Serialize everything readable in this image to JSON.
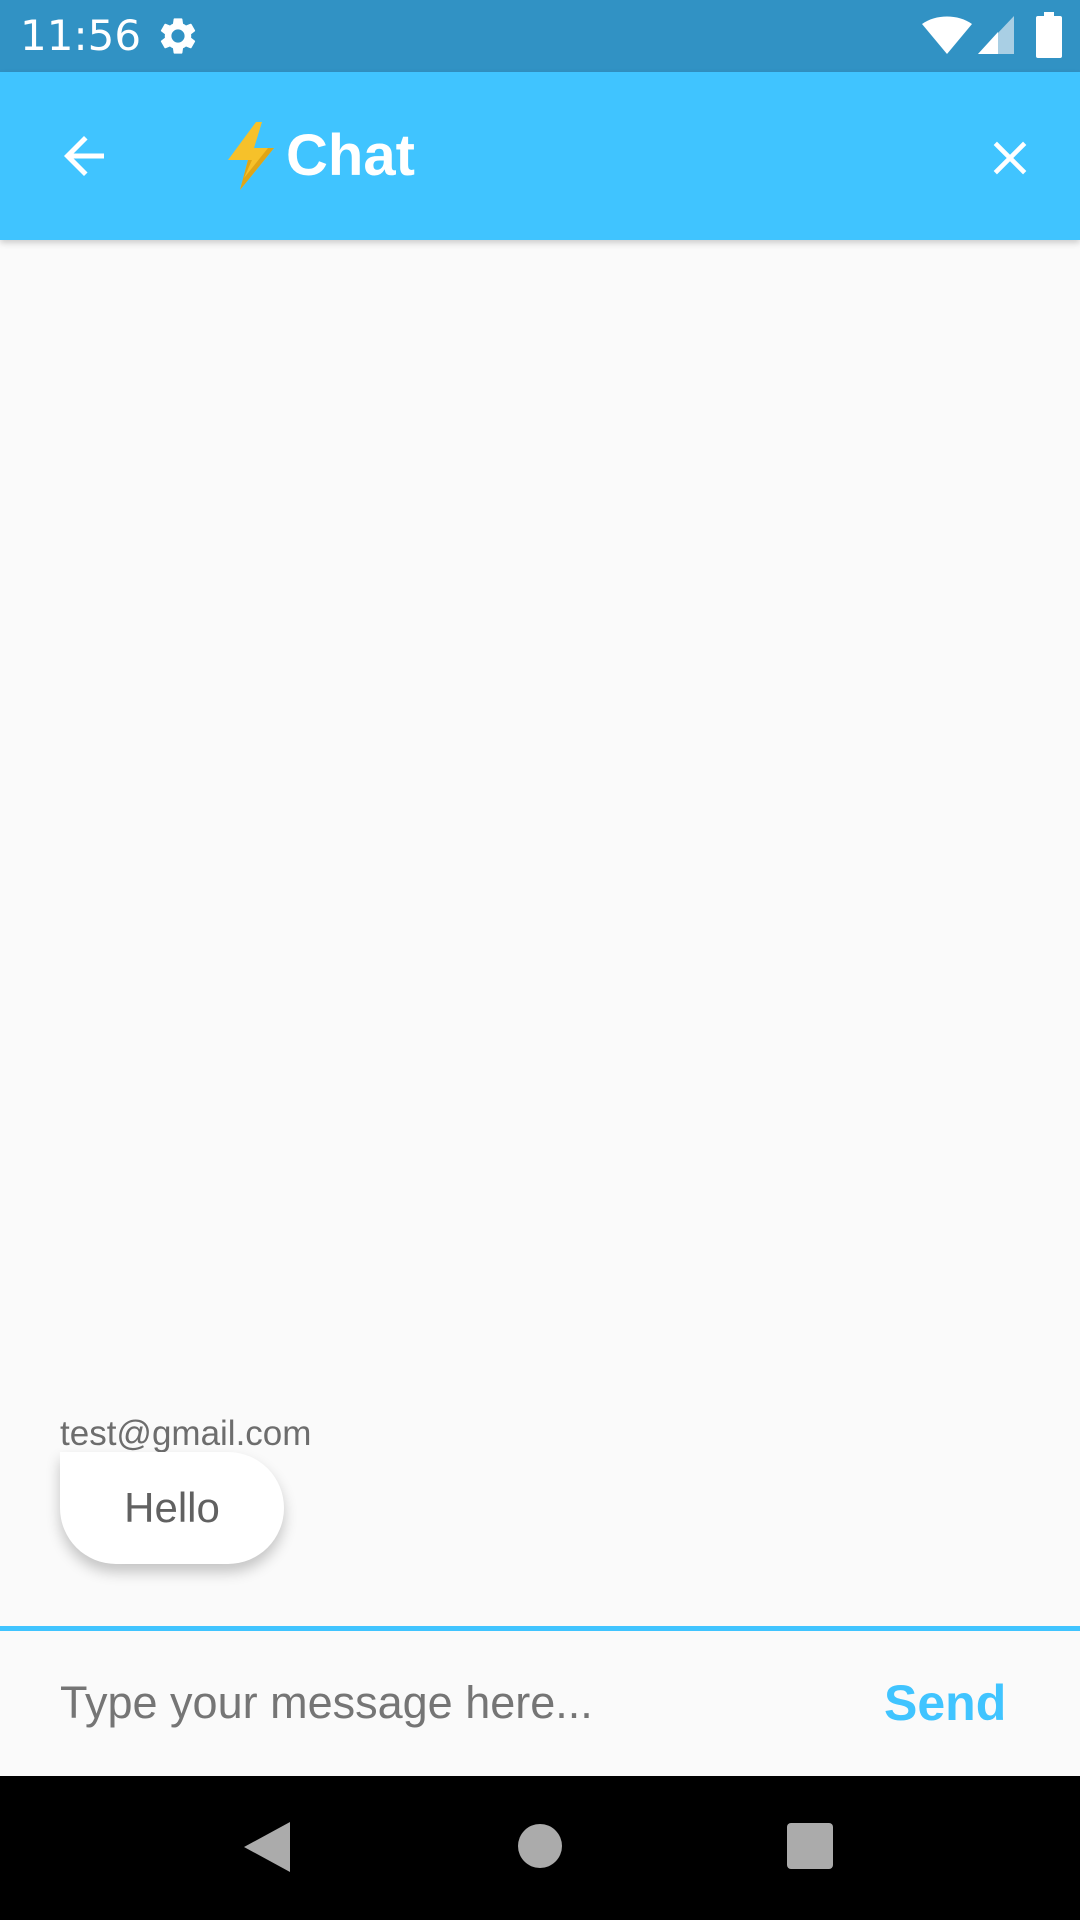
{
  "status_bar": {
    "time": "11:56",
    "icons": [
      "gear-icon",
      "wifi-icon",
      "signal-icon",
      "battery-icon"
    ]
  },
  "app_bar": {
    "back_icon": "arrow-back-icon",
    "title_icon": "lightning-bolt-icon",
    "title": "Chat",
    "close_icon": "close-icon",
    "background_color": "#40c4ff"
  },
  "messages": [
    {
      "sender": "test@gmail.com",
      "text": "Hello"
    }
  ],
  "composer": {
    "placeholder": "Type your message here...",
    "value": "",
    "send_label": "Send",
    "accent_color": "#40c4ff"
  },
  "nav_bar": {
    "icons": [
      "nav-back-icon",
      "nav-home-icon",
      "nav-recents-icon"
    ]
  }
}
